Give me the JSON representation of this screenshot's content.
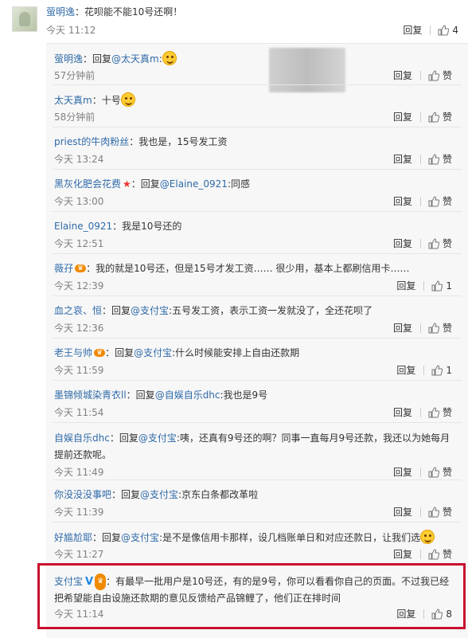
{
  "main_comment": {
    "user": "萤明逸",
    "text": "：花呗能不能10号还啊！",
    "time": "今天 11:12",
    "reply_label": "回复",
    "like_count": "4"
  },
  "replies": [
    {
      "user": "萤明逸",
      "prefix": "：回复",
      "mention": "@太天真m",
      "text": ":",
      "time": "57分钟前",
      "reply_label": "回复",
      "like_label": "赞"
    },
    {
      "user": "太天真m",
      "prefix": "：十号",
      "mention": "",
      "text": "",
      "time": "58分钟前",
      "reply_label": "回复",
      "like_label": "赞"
    },
    {
      "user": "priest的牛肉粉丝",
      "prefix": "：我也是，15号发工资",
      "mention": "",
      "text": "",
      "time": "今天 13:24",
      "reply_label": "回复",
      "like_label": "赞"
    },
    {
      "user": "黑灰化肥会花费",
      "prefix": "：回复",
      "mention": "@Elaine_0921",
      "text": ":同感",
      "time": "今天 13:00",
      "reply_label": "回复",
      "like_label": "赞"
    },
    {
      "user": "Elaine_0921",
      "prefix": "：我是10号还的",
      "mention": "",
      "text": "",
      "time": "今天 12:51",
      "reply_label": "回复",
      "like_label": "赞"
    },
    {
      "user": "薇孖",
      "prefix": "：我的就是10号还，但是15号才发工资…… 很少用，基本上都刷信用卡……",
      "mention": "",
      "text": "",
      "time": "今天 12:39",
      "reply_label": "回复",
      "like_label": "1"
    },
    {
      "user": "血之哀、恒",
      "prefix": "：回复",
      "mention": "@支付宝",
      "text": ":五号发工资，表示工资一发就没了，全还花呗了",
      "time": "今天 12:36",
      "reply_label": "回复",
      "like_label": "赞"
    },
    {
      "user": "老王与帅",
      "prefix": "：回复",
      "mention": "@支付宝",
      "text": ":什么时候能安排上自由还款期",
      "time": "今天 11:59",
      "reply_label": "回复",
      "like_label": "1"
    },
    {
      "user": "墨锦倾城染青衣ll",
      "prefix": "：回复",
      "mention": "@自娱自乐dhc",
      "text": ":我也是9号",
      "time": "今天 11:54",
      "reply_label": "回复",
      "like_label": "赞"
    },
    {
      "user": "自娱自乐dhc",
      "prefix": "：回复",
      "mention": "@支付宝",
      "text": ":咦，还真有9号还的啊？同事一直每月9号还款，我还以为她每月提前还款呢。",
      "time": "今天 11:49",
      "reply_label": "回复",
      "like_label": "赞"
    },
    {
      "user": "你没没没事吧",
      "prefix": "：回复",
      "mention": "@支付宝",
      "text": ":京东白条都改革啦",
      "time": "今天 11:39",
      "reply_label": "回复",
      "like_label": "赞"
    },
    {
      "user": "好尴尬耶",
      "prefix": "：回复",
      "mention": "@支付宝",
      "text": ":是不是像信用卡那样，设几档账单日和对应还款日，让我们选",
      "time": "今天 11:27",
      "reply_label": "回复",
      "like_label": "赞"
    },
    {
      "user": "支付宝",
      "prefix": "：有最早一批用户是10号还，有的是9号，你可以看看你自己的页面。不过我已经把希望能自由设施还款期的意见反馈给产品锦鲤了，他们正在排时间",
      "mention": "",
      "text": "",
      "time": "今天 11:14",
      "reply_label": "回复",
      "like_label": "8"
    }
  ],
  "icons": {
    "thumb": "thumb-up-icon",
    "emoji": "smile-emoji-icon",
    "vip": "vip-badge-icon",
    "verified": "verified-v-icon",
    "star": "star-icon"
  },
  "colors": {
    "link": "#2f6aa8",
    "highlight": "#c8102e",
    "muted": "#808080"
  }
}
